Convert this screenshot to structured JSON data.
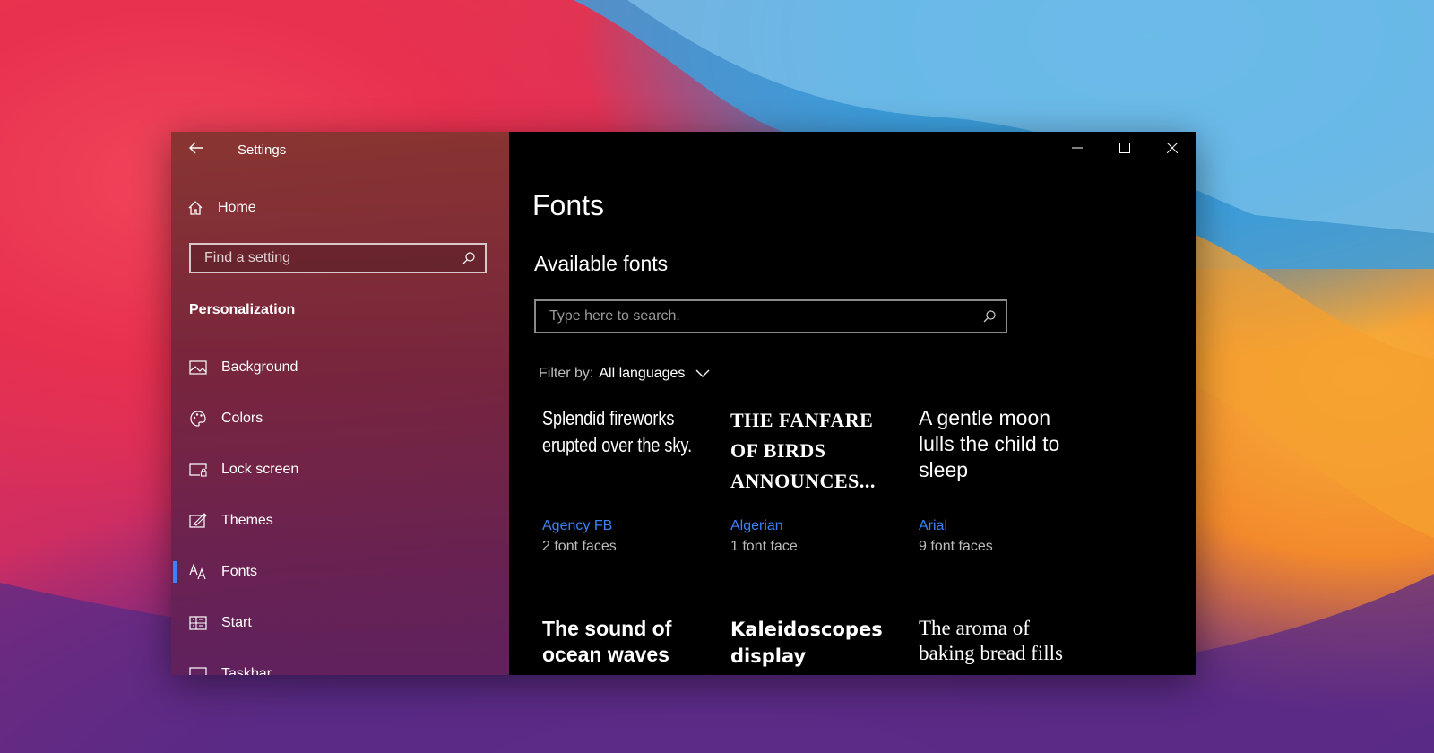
{
  "window": {
    "title": "Settings"
  },
  "sidebar": {
    "home_label": "Home",
    "search_placeholder": "Find a setting",
    "section_title": "Personalization",
    "items": [
      {
        "label": "Background",
        "icon": "image-icon"
      },
      {
        "label": "Colors",
        "icon": "palette-icon"
      },
      {
        "label": "Lock screen",
        "icon": "lock-screen-icon"
      },
      {
        "label": "Themes",
        "icon": "themes-icon"
      },
      {
        "label": "Fonts",
        "icon": "fonts-icon",
        "active": true
      },
      {
        "label": "Start",
        "icon": "start-icon"
      },
      {
        "label": "Taskbar",
        "icon": "taskbar-icon"
      }
    ]
  },
  "main": {
    "title": "Fonts",
    "subtitle": "Available fonts",
    "search_placeholder": "Type here to search.",
    "filter_label": "Filter by:",
    "filter_value": "All languages",
    "fonts": [
      {
        "sample": "Splendid fireworks erupted over the sky.",
        "name": "Agency FB",
        "faces": "2 font faces"
      },
      {
        "sample": "THE FANFARE OF BIRDS ANNOUNCES...",
        "name": "Algerian",
        "faces": "1 font face"
      },
      {
        "sample": "A gentle moon lulls the child to sleep",
        "name": "Arial",
        "faces": "9 font faces"
      },
      {
        "sample": "The sound of ocean waves",
        "name": "",
        "faces": ""
      },
      {
        "sample": "Kaleidoscopes display",
        "name": "",
        "faces": ""
      },
      {
        "sample": "The aroma of baking bread fills",
        "name": "",
        "faces": ""
      }
    ]
  },
  "colors": {
    "accent": "#3b82f6",
    "main_bg": "#000000"
  }
}
